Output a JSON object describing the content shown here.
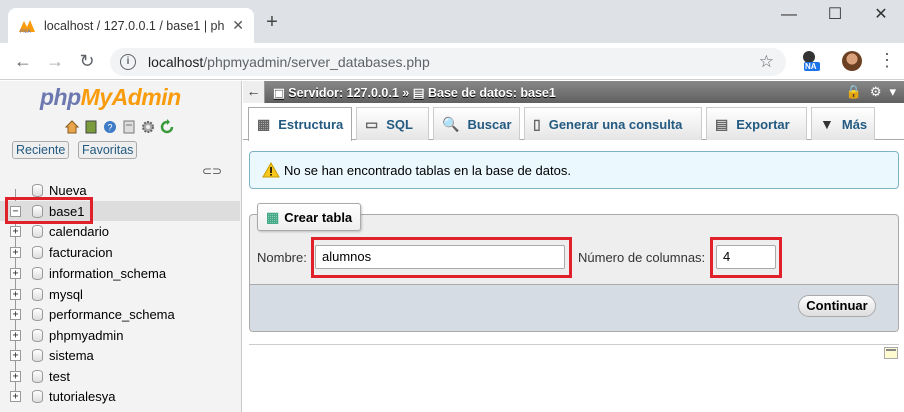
{
  "browser": {
    "tab_title": "localhost / 127.0.0.1 / base1 | php",
    "tab_close": "✕",
    "new_tab": "+",
    "url_host": "localhost",
    "url_path": "/phpmyadmin/server_databases.php",
    "ext_label": "NA"
  },
  "sidebar": {
    "logo_php": "php",
    "logo_myadmin": "MyAdmin",
    "btn_recent": "Reciente",
    "btn_favorites": "Favoritas",
    "tree": [
      {
        "label": "Nueva",
        "expander": ""
      },
      {
        "label": "base1",
        "expander": "−"
      },
      {
        "label": "calendario",
        "expander": "+"
      },
      {
        "label": "facturacion",
        "expander": "+"
      },
      {
        "label": "information_schema",
        "expander": "+"
      },
      {
        "label": "mysql",
        "expander": "+"
      },
      {
        "label": "performance_schema",
        "expander": "+"
      },
      {
        "label": "phpmyadmin",
        "expander": "+"
      },
      {
        "label": "sistema",
        "expander": "+"
      },
      {
        "label": "test",
        "expander": "+"
      },
      {
        "label": "tutorialesya",
        "expander": "+"
      }
    ]
  },
  "breadcrumb": {
    "server": "Servidor: 127.0.0.1",
    "sep": "»",
    "database": "Base de datos: base1"
  },
  "tabs": [
    {
      "label": "Estructura",
      "icon": "structure-icon",
      "active": true
    },
    {
      "label": "SQL",
      "icon": "sql-icon"
    },
    {
      "label": "Buscar",
      "icon": "search-icon"
    },
    {
      "label": "Generar una consulta",
      "icon": "query-icon"
    },
    {
      "label": "Exportar",
      "icon": "export-icon"
    },
    {
      "label": "Más",
      "icon": "more-icon"
    }
  ],
  "notice": {
    "text": "No se han encontrado tablas en la base de datos."
  },
  "create_table": {
    "legend": "Crear tabla",
    "name_label": "Nombre:",
    "name_value": "alumnos",
    "columns_label": "Número de columnas:",
    "columns_value": "4",
    "submit": "Continuar"
  },
  "colors": {
    "highlight_red": "#e0212b",
    "link_blue": "#235a81",
    "logo_php": "#6c78af",
    "logo_myadmin": "#f89c0e"
  }
}
